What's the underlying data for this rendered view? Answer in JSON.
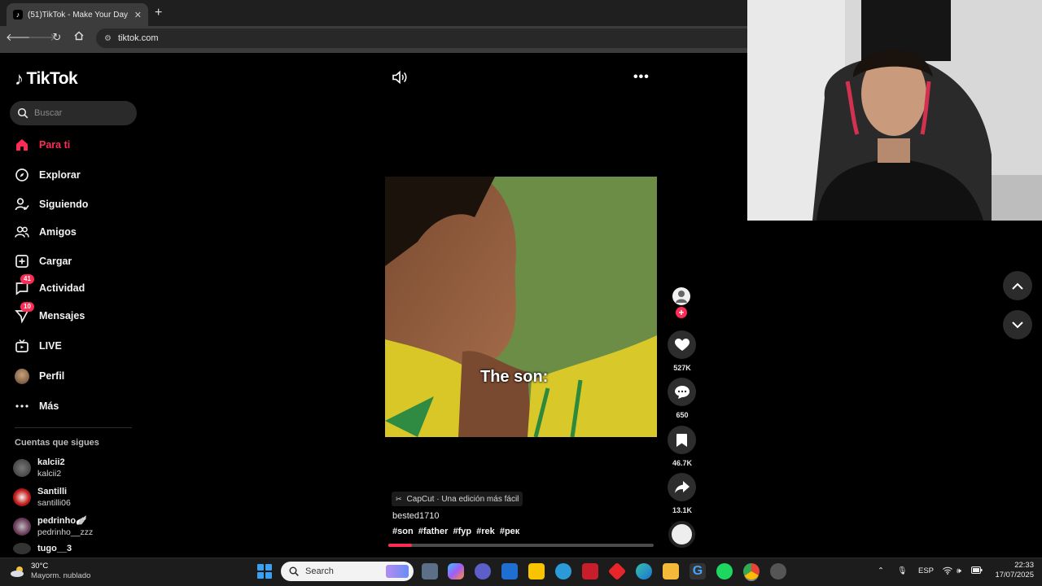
{
  "browser": {
    "tab_title": "(51)TikTok - Make Your Day",
    "tab_close": "✕",
    "new_tab": "+",
    "url": "tiktok.com"
  },
  "tiktok": {
    "logo_text": "TikTok",
    "search_placeholder": "Buscar",
    "nav": [
      {
        "label": "Para ti",
        "icon": "home-icon",
        "active": true
      },
      {
        "label": "Explorar",
        "icon": "compass-icon"
      },
      {
        "label": "Siguiendo",
        "icon": "following-icon"
      },
      {
        "label": "Amigos",
        "icon": "friends-icon"
      },
      {
        "label": "Cargar",
        "icon": "upload-icon"
      },
      {
        "label": "Actividad",
        "icon": "activity-icon",
        "badge": "41"
      },
      {
        "label": "Mensajes",
        "icon": "messages-icon",
        "badge": "10"
      },
      {
        "label": "LIVE",
        "icon": "live-icon"
      },
      {
        "label": "Perfil",
        "icon": "profile-avatar"
      },
      {
        "label": "Más",
        "icon": "more-dots-icon"
      }
    ],
    "followed_title": "Cuentas que sigues",
    "followed": [
      {
        "name": "kalcii2",
        "handle": "kalcii2"
      },
      {
        "name": "Santilli",
        "handle": "santilli06"
      },
      {
        "name": "pedrinho🪽",
        "handle": "pedrinho__zzz"
      },
      {
        "name": "tugo__3",
        "handle": ""
      }
    ]
  },
  "video": {
    "overlay_text": "The son:",
    "capcut": "CapCut · Una edición más fácil",
    "author": "bested1710",
    "tags": "#son #father #fyp #rek #рек",
    "progress": 0.09,
    "likes": "527K",
    "comments": "650",
    "saves": "46.7K",
    "shares": "13.1K",
    "follow_plus": "+"
  },
  "taskbar": {
    "weather_temp": "30°C",
    "weather_desc": "Mayorm. nublado",
    "search_placeholder": "Search",
    "lang": "ESP",
    "time": "22:33",
    "date": "17/07/2025"
  }
}
